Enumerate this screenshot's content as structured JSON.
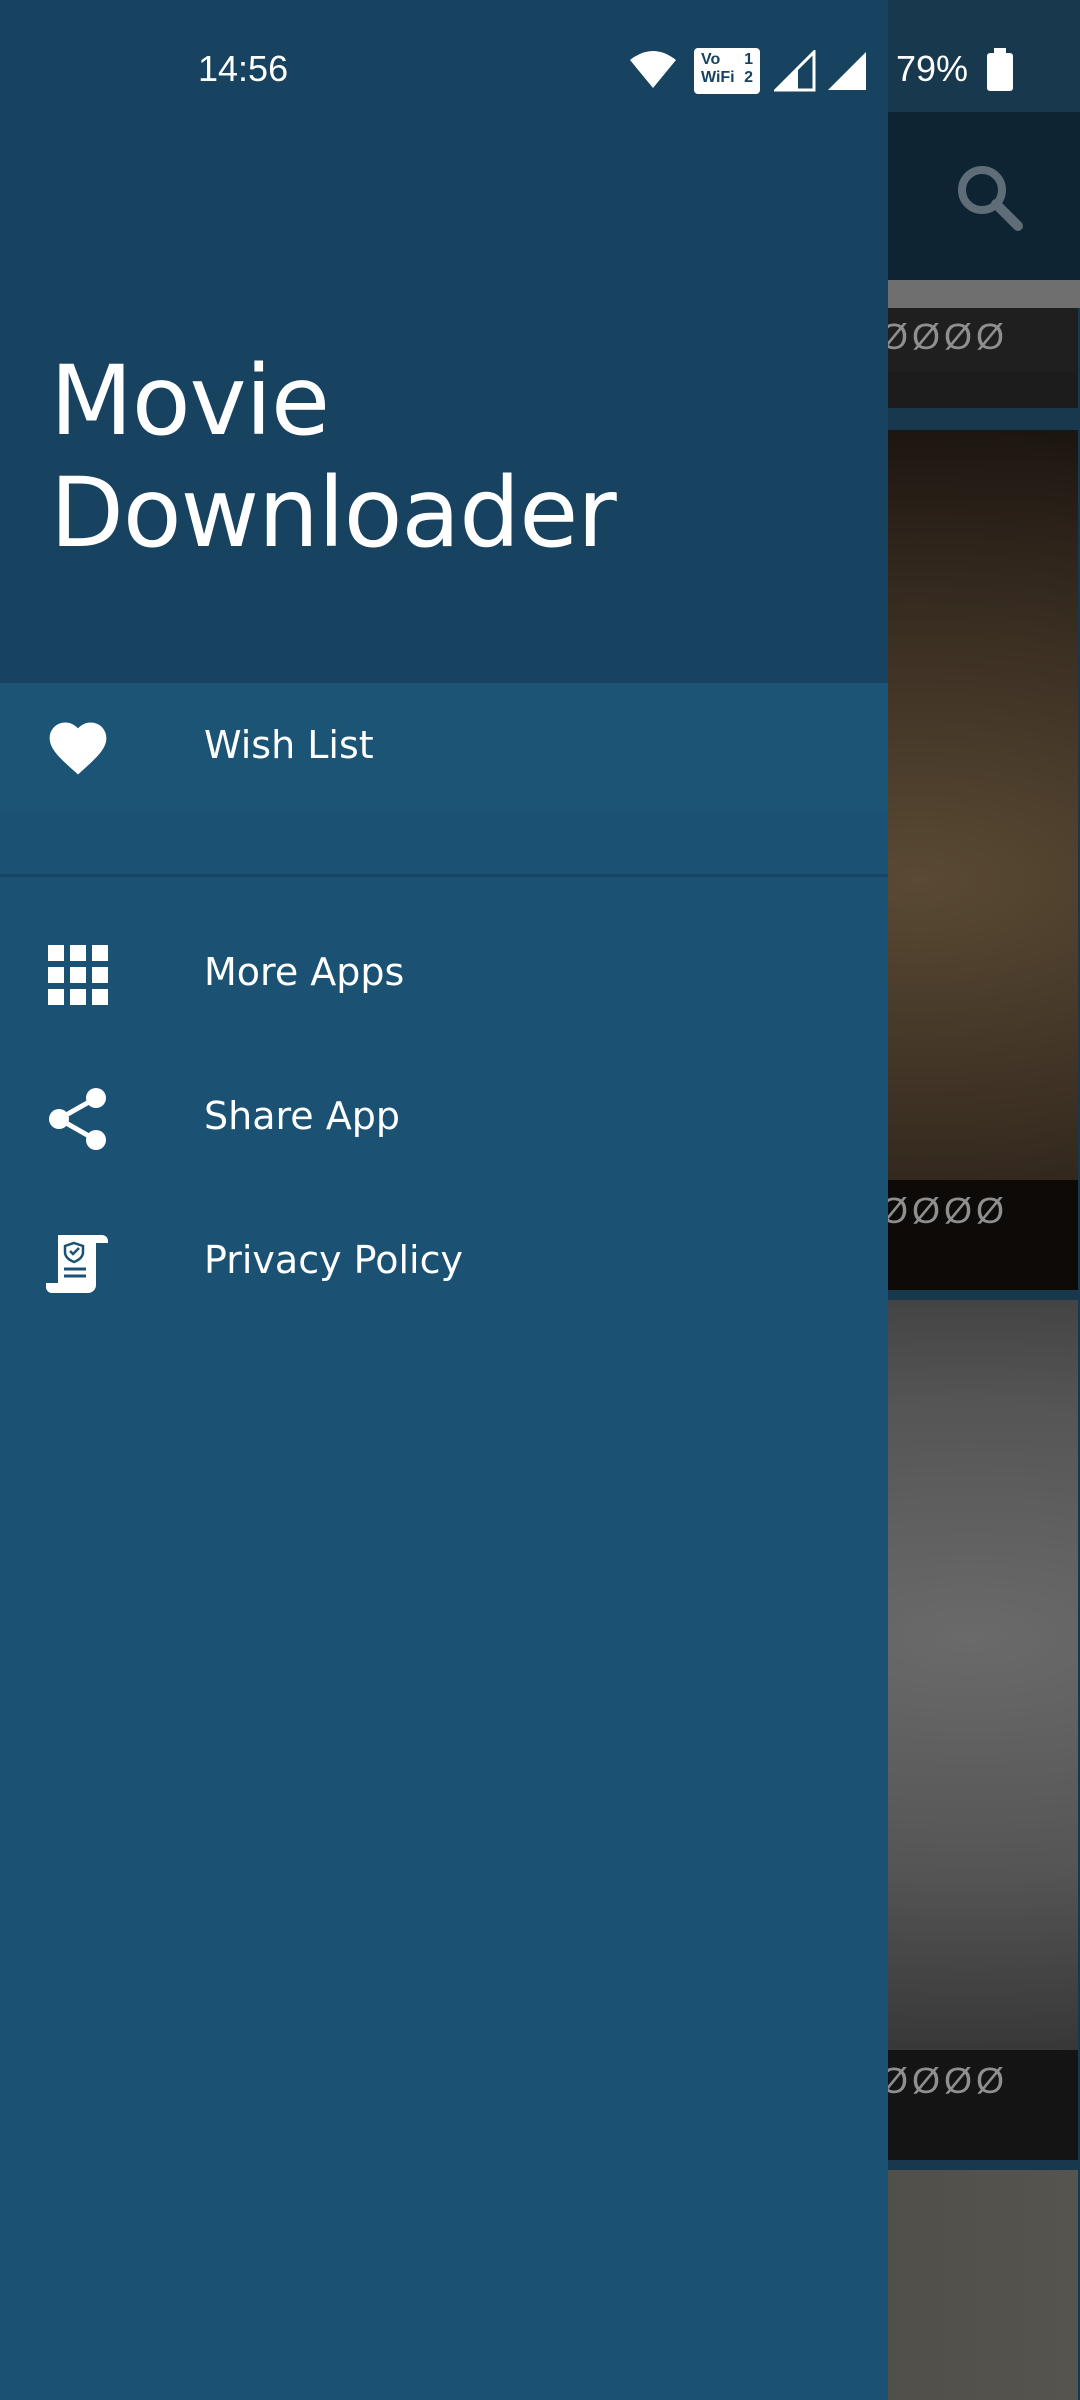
{
  "status_bar": {
    "time": "14:56",
    "battery_percent": "79%",
    "volte_label_top": "Vo",
    "volte_label_bottom": "WiFi",
    "sim_top": "1",
    "sim_bottom": "2"
  },
  "drawer": {
    "title": "Movie Downloader",
    "items": [
      {
        "label": "Wish List",
        "icon": "heart-icon",
        "selected": true
      },
      {
        "label": "More Apps",
        "icon": "apps-grid-icon"
      },
      {
        "label": "Share App",
        "icon": "share-icon"
      },
      {
        "label": "Privacy Policy",
        "icon": "policy-scroll-icon"
      }
    ]
  },
  "background_list": {
    "captions": [
      "ØØØØ",
      "ØØØØ",
      "ØØØØ"
    ]
  },
  "colors": {
    "drawer_bg": "#1b5173",
    "drawer_header_bg": "#174260",
    "toolbar_bg": "#0f2433"
  }
}
